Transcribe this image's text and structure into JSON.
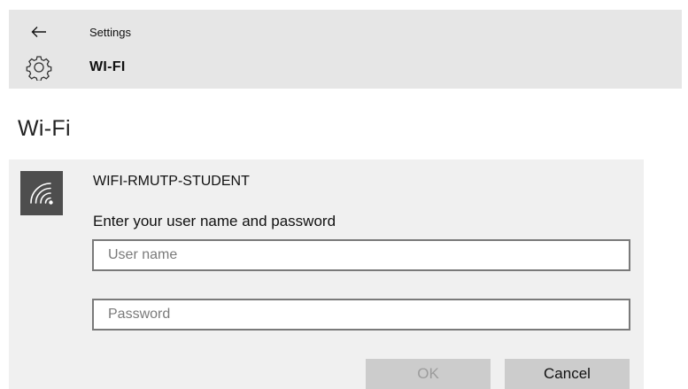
{
  "header": {
    "back_icon": "arrow-left-icon",
    "app_title": "Settings",
    "page_icon": "gear-icon",
    "page_title": "WI-FI"
  },
  "main": {
    "section_title": "Wi-Fi"
  },
  "network": {
    "icon": "wifi-icon",
    "name": "WIFI-RMUTP-STUDENT",
    "prompt": "Enter your user name and password",
    "username": {
      "value": "",
      "placeholder": "User name"
    },
    "password": {
      "value": "",
      "placeholder": "Password"
    },
    "ok_label": "OK",
    "ok_enabled": false,
    "cancel_label": "Cancel"
  },
  "colors": {
    "header_bg": "#e6e6e6",
    "panel_bg": "#f0f0f0",
    "wifi_tile_bg": "#4e4e4e",
    "button_bg": "#cccccc",
    "disabled_text": "#9c9c9c"
  }
}
